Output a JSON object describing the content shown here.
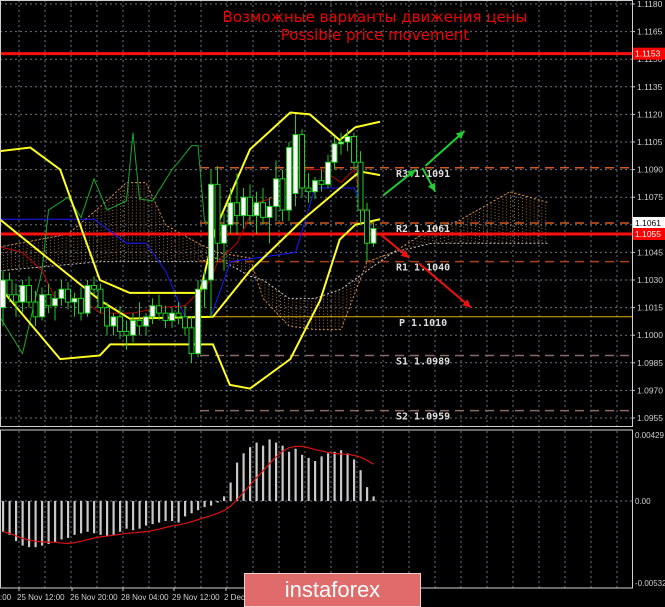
{
  "chart_data": {
    "type": "candlestick",
    "title": "Возможные варианты движения цены",
    "subtitle": "Possible price movement",
    "price_axis": {
      "min": 1.0955,
      "max": 1.118,
      "step": 0.0015,
      "ticks": [
        "1.1180",
        "1.1165",
        "1.1150",
        "1.1135",
        "1.1120",
        "1.1105",
        "1.1090",
        "1.1075",
        "1.1060",
        "1.1045",
        "1.1030",
        "1.1015",
        "1.1000",
        "1.0985",
        "1.0970",
        "1.0955"
      ]
    },
    "price_tags": [
      {
        "label": "1.1153",
        "value": 1.1153,
        "color": "#ff0000"
      },
      {
        "label": "1.1061",
        "value": 1.1061,
        "color": "#ffffff"
      },
      {
        "label": "1.1055",
        "value": 1.1055,
        "color": "#ff0000"
      }
    ],
    "time_labels": [
      ":00",
      "25 Nov 12:00",
      "26 Nov 20:00",
      "28 Nov 04:00",
      "29 Nov 12:00",
      "2 Dec"
    ],
    "candles": [
      [
        1.1015,
        1.1035,
        1.1005,
        1.103
      ],
      [
        1.103,
        1.1034,
        1.1018,
        1.1022
      ],
      [
        1.1022,
        1.1028,
        1.101,
        1.1018
      ],
      [
        1.1018,
        1.103,
        1.1012,
        1.1027
      ],
      [
        1.1027,
        1.1032,
        1.1015,
        1.1018
      ],
      [
        1.1018,
        1.1024,
        1.1005,
        1.101
      ],
      [
        1.101,
        1.1026,
        1.1008,
        1.1022
      ],
      [
        1.1022,
        1.1028,
        1.1012,
        1.1016
      ],
      [
        1.1016,
        1.1024,
        1.1008,
        1.102
      ],
      [
        1.102,
        1.103,
        1.1016,
        1.1025
      ],
      [
        1.1025,
        1.1029,
        1.1014,
        1.1018
      ],
      [
        1.1018,
        1.1023,
        1.101,
        1.102
      ],
      [
        1.102,
        1.1026,
        1.1008,
        1.1012
      ],
      [
        1.1012,
        1.103,
        1.101,
        1.1027
      ],
      [
        1.1027,
        1.1032,
        1.1022,
        1.1025
      ],
      [
        1.1025,
        1.1028,
        1.1012,
        1.1015
      ],
      [
        1.1015,
        1.1018,
        1.1,
        1.1005
      ],
      [
        1.1005,
        1.1012,
        1.1,
        1.101
      ],
      [
        1.101,
        1.1016,
        1.0998,
        1.1002
      ],
      [
        1.1002,
        1.1008,
        1.0992,
        1.1
      ],
      [
        1.1,
        1.1012,
        1.0996,
        1.1008
      ],
      [
        1.1008,
        1.1018,
        1.1,
        1.1005
      ],
      [
        1.1005,
        1.1012,
        1.1,
        1.101
      ],
      [
        1.101,
        1.102,
        1.1006,
        1.1016
      ],
      [
        1.1016,
        1.1022,
        1.1008,
        1.1012
      ],
      [
        1.1012,
        1.1016,
        1.1004,
        1.1008
      ],
      [
        1.1008,
        1.1015,
        1.1004,
        1.1012
      ],
      [
        1.1012,
        1.1018,
        1.1006,
        1.101
      ],
      [
        1.101,
        1.1016,
        1.1,
        1.1004
      ],
      [
        1.1004,
        1.101,
        1.0985,
        1.099
      ],
      [
        1.099,
        1.103,
        1.0988,
        1.1025
      ],
      [
        1.1025,
        1.1035,
        1.1015,
        1.103
      ],
      [
        1.103,
        1.109,
        1.101,
        1.1082
      ],
      [
        1.1082,
        1.1092,
        1.104,
        1.105
      ],
      [
        1.105,
        1.1066,
        1.1035,
        1.106
      ],
      [
        1.106,
        1.108,
        1.1055,
        1.1072
      ],
      [
        1.1072,
        1.1088,
        1.1055,
        1.1065
      ],
      [
        1.1065,
        1.108,
        1.1058,
        1.1075
      ],
      [
        1.1075,
        1.1082,
        1.106,
        1.1065
      ],
      [
        1.1065,
        1.1078,
        1.1055,
        1.1072
      ],
      [
        1.1072,
        1.108,
        1.106,
        1.1064
      ],
      [
        1.1064,
        1.1075,
        1.105,
        1.107
      ],
      [
        1.107,
        1.1095,
        1.1062,
        1.1085
      ],
      [
        1.1085,
        1.109,
        1.1062,
        1.1068
      ],
      [
        1.1068,
        1.1105,
        1.1062,
        1.1102
      ],
      [
        1.1077,
        1.112,
        1.107,
        1.1109
      ],
      [
        1.1109,
        1.1112,
        1.1075,
        1.108
      ],
      [
        1.108,
        1.1088,
        1.1072,
        1.1078
      ],
      [
        1.1078,
        1.1086,
        1.1074,
        1.1084
      ],
      [
        1.1084,
        1.109,
        1.1078,
        1.1082
      ],
      [
        1.1082,
        1.1098,
        1.108,
        1.1094
      ],
      [
        1.1094,
        1.1108,
        1.109,
        1.1104
      ],
      [
        1.1104,
        1.111,
        1.1098,
        1.1105
      ],
      [
        1.1105,
        1.1112,
        1.11,
        1.1108
      ],
      [
        1.1108,
        1.111,
        1.109,
        1.1094
      ],
      [
        1.1094,
        1.11,
        1.106,
        1.1068
      ],
      [
        1.1068,
        1.1072,
        1.104,
        1.105
      ],
      [
        1.105,
        1.1062,
        1.1048,
        1.1058
      ]
    ],
    "bollinger": {
      "upper": [
        [
          -0.5,
          1.11
        ],
        [
          4.2,
          1.1102
        ],
        [
          8.8,
          1.109
        ],
        [
          14.9,
          1.103
        ],
        [
          19.5,
          1.1023
        ],
        [
          30.3,
          1.1023
        ],
        [
          32.6,
          1.1057
        ],
        [
          38,
          1.1101
        ],
        [
          44.2,
          1.1121
        ],
        [
          47.2,
          1.112
        ],
        [
          51.8,
          1.1106
        ],
        [
          54.2,
          1.1113
        ],
        [
          58,
          1.1116
        ]
      ],
      "middle": [
        [
          -0.5,
          1.1063
        ],
        [
          14.9,
          1.1019
        ],
        [
          19.5,
          1.1009
        ],
        [
          32.3,
          1.101
        ],
        [
          38,
          1.1035
        ],
        [
          46.2,
          1.1063
        ],
        [
          54.9,
          1.1089
        ],
        [
          58,
          1.1087
        ]
      ],
      "lower": [
        [
          -0.5,
          1.1026
        ],
        [
          8.8,
          1.0987
        ],
        [
          14.9,
          1.0989
        ],
        [
          16.5,
          1.0995
        ],
        [
          32.3,
          1.0995
        ],
        [
          34.9,
          1.0973
        ],
        [
          38,
          1.0971
        ],
        [
          44.2,
          1.0987
        ],
        [
          48.8,
          1.1019
        ],
        [
          51.8,
          1.1052
        ],
        [
          54.2,
          1.106
        ],
        [
          58,
          1.1063
        ]
      ]
    },
    "ichimoku": {
      "span_a": [
        [
          -0.5,
          1.1048
        ],
        [
          10,
          1.1055
        ],
        [
          15,
          1.107
        ],
        [
          19,
          1.1083
        ],
        [
          22,
          1.1083
        ],
        [
          25,
          1.106
        ],
        [
          30,
          1.105
        ],
        [
          33,
          1.1045
        ],
        [
          38,
          1.1042
        ],
        [
          40,
          1.102
        ],
        [
          44,
          1.1005
        ],
        [
          48,
          1.1003
        ],
        [
          52,
          1.1003
        ],
        [
          56,
          1.104
        ],
        [
          60,
          1.1045
        ],
        [
          66,
          1.1058
        ],
        [
          70,
          1.1062
        ],
        [
          74,
          1.107
        ],
        [
          78,
          1.1078
        ],
        [
          84,
          1.1072
        ]
      ],
      "span_b": [
        [
          -0.5,
          1.1035
        ],
        [
          15,
          1.104
        ],
        [
          30,
          1.104
        ],
        [
          33,
          1.1042
        ],
        [
          38,
          1.1032
        ],
        [
          40,
          1.103
        ],
        [
          44,
          1.102
        ],
        [
          48,
          1.102
        ],
        [
          52,
          1.1025
        ],
        [
          56,
          1.1035
        ],
        [
          60,
          1.1045
        ],
        [
          66,
          1.105
        ],
        [
          84,
          1.105
        ]
      ],
      "tenkan": [
        [
          -0.5,
          1.1048
        ],
        [
          3,
          1.1045
        ],
        [
          6,
          1.1035
        ],
        [
          8,
          1.102
        ],
        [
          12,
          1.102
        ],
        [
          15,
          1.1012
        ],
        [
          20,
          1.1012
        ],
        [
          24,
          1.1015
        ],
        [
          28,
          1.1016
        ],
        [
          32,
          1.103
        ],
        [
          33,
          1.104
        ],
        [
          36,
          1.105
        ],
        [
          39,
          1.1072
        ],
        [
          42,
          1.1075
        ],
        [
          45,
          1.109
        ],
        [
          49,
          1.109
        ],
        [
          52,
          1.1083
        ],
        [
          54,
          1.109
        ],
        [
          56,
          1.106
        ],
        [
          57,
          1.1055
        ]
      ],
      "kijun": [
        [
          -0.5,
          1.1063
        ],
        [
          14,
          1.1063
        ],
        [
          19,
          1.105
        ],
        [
          22,
          1.105
        ],
        [
          25,
          1.1035
        ],
        [
          28,
          1.101
        ],
        [
          32,
          1.101
        ],
        [
          33,
          1.102
        ],
        [
          35,
          1.104
        ],
        [
          45,
          1.1045
        ],
        [
          48,
          1.108
        ],
        [
          54,
          1.108
        ],
        [
          57,
          1.1055
        ]
      ],
      "chikou": [
        [
          -0.5,
          1.101
        ],
        [
          3,
          1.099
        ],
        [
          6,
          1.1035
        ],
        [
          7,
          1.1068
        ],
        [
          10,
          1.1075
        ],
        [
          12,
          1.1064
        ],
        [
          14,
          1.1085
        ],
        [
          16,
          1.1068
        ],
        [
          19,
          1.1073
        ],
        [
          20,
          1.111
        ],
        [
          21,
          1.1074
        ],
        [
          23,
          1.1073
        ],
        [
          26,
          1.109
        ],
        [
          27,
          1.1094
        ],
        [
          29,
          1.1103
        ],
        [
          30,
          1.1103
        ],
        [
          31,
          1.1062
        ],
        [
          32,
          1.106
        ]
      ]
    },
    "pivots": [
      {
        "label": "R3  1.1091",
        "value": 1.1091,
        "color": "#d2581e"
      },
      {
        "label": "R2  1.1061",
        "value": 1.1061,
        "color": "#d2581e"
      },
      {
        "label": "R1  1.1040",
        "value": 1.104,
        "color": "#a8421a"
      },
      {
        "label": "P  1.1010",
        "value": 1.101,
        "color": "#e0b000"
      },
      {
        "label": "S1  1.0989",
        "value": 1.0989,
        "color": "#8a6a66"
      },
      {
        "label": "S2  1.0959",
        "value": 1.0959,
        "color": "#8a6a66"
      }
    ],
    "resistance_lines": [
      1.1153,
      1.1055
    ],
    "arrows": [
      {
        "color": "#22cc33",
        "from": [
          58.5,
          1.1076
        ],
        "to": [
          63.5,
          1.109
        ]
      },
      {
        "color": "#22cc33",
        "from": [
          64.5,
          1.1091
        ],
        "to": [
          66.5,
          1.1078
        ]
      },
      {
        "color": "#22cc33",
        "from": [
          65,
          1.1092
        ],
        "to": [
          71,
          1.1111
        ]
      },
      {
        "color": "#ee1111",
        "from": [
          58,
          1.1055
        ],
        "to": [
          62.5,
          1.1042
        ]
      },
      {
        "color": "#ee1111",
        "from": [
          64,
          1.1039
        ],
        "to": [
          72,
          1.1015
        ]
      }
    ],
    "macd": {
      "axis_labels": [
        "0.00429",
        "0.00",
        "-0.00532"
      ],
      "max": 0.00429,
      "min": -0.00532,
      "histogram": [
        -0.002,
        -0.0022,
        -0.0026,
        -0.0029,
        -0.003,
        -0.003,
        -0.0029,
        -0.0028,
        -0.0027,
        -0.0025,
        -0.0024,
        -0.0022,
        -0.0021,
        -0.002,
        -0.0021,
        -0.0022,
        -0.0023,
        -0.0022,
        -0.002,
        -0.0018,
        -0.0019,
        -0.0018,
        -0.0016,
        -0.0015,
        -0.0014,
        -0.0013,
        -0.0013,
        -0.0014,
        -0.001,
        -0.0008,
        -0.0006,
        -0.0004,
        -0.0003,
        -0.0001,
        0.0003,
        0.0012,
        0.0025,
        0.0031,
        0.0035,
        0.0038,
        0.0036,
        0.004,
        0.0038,
        0.0036,
        0.0032,
        0.0034,
        0.003,
        0.0028,
        0.0026,
        0.0029,
        0.0031,
        0.0032,
        0.0033,
        0.0031,
        0.0027,
        0.002,
        0.0009,
        0.0003
      ],
      "signal_period": 9
    }
  },
  "logo": "instaforex"
}
